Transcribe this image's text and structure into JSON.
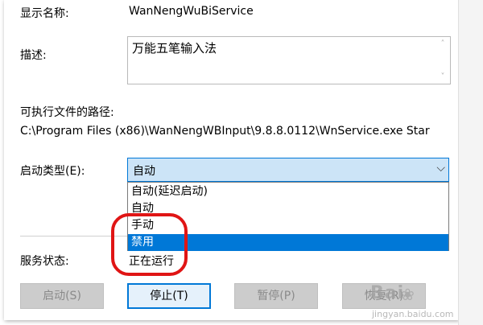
{
  "display_name": {
    "label": "显示名称:",
    "value": "WanNengWuBiService"
  },
  "description": {
    "label": "描述:",
    "value": "万能五笔输入法"
  },
  "exe_path": {
    "label": "可执行文件的路径:",
    "value": "C:\\Program Files (x86)\\WanNengWBInput\\9.8.8.0112\\WnService.exe Star"
  },
  "startup_type": {
    "label": "启动类型(E):",
    "selected": "自动",
    "options": [
      "自动(延迟启动)",
      "自动",
      "手动",
      "禁用"
    ],
    "highlighted_index": 3
  },
  "service_status": {
    "label": "服务状态:",
    "value": "正在运行"
  },
  "buttons": {
    "start": "启动(S)",
    "stop": "停止(T)",
    "pause": "暂停(P)",
    "resume": "恢复(R)"
  },
  "watermark": {
    "logo": "Bai",
    "sub": "jingyan.baidu.com"
  },
  "colors": {
    "selection": "#0078d7",
    "combo_bg": "#cce4f7",
    "annotation": "#e01515"
  },
  "icons": {
    "dropdown": "chevron-down-icon",
    "scroll_up": "chevron-up-icon",
    "scroll_down": "chevron-down-icon"
  }
}
